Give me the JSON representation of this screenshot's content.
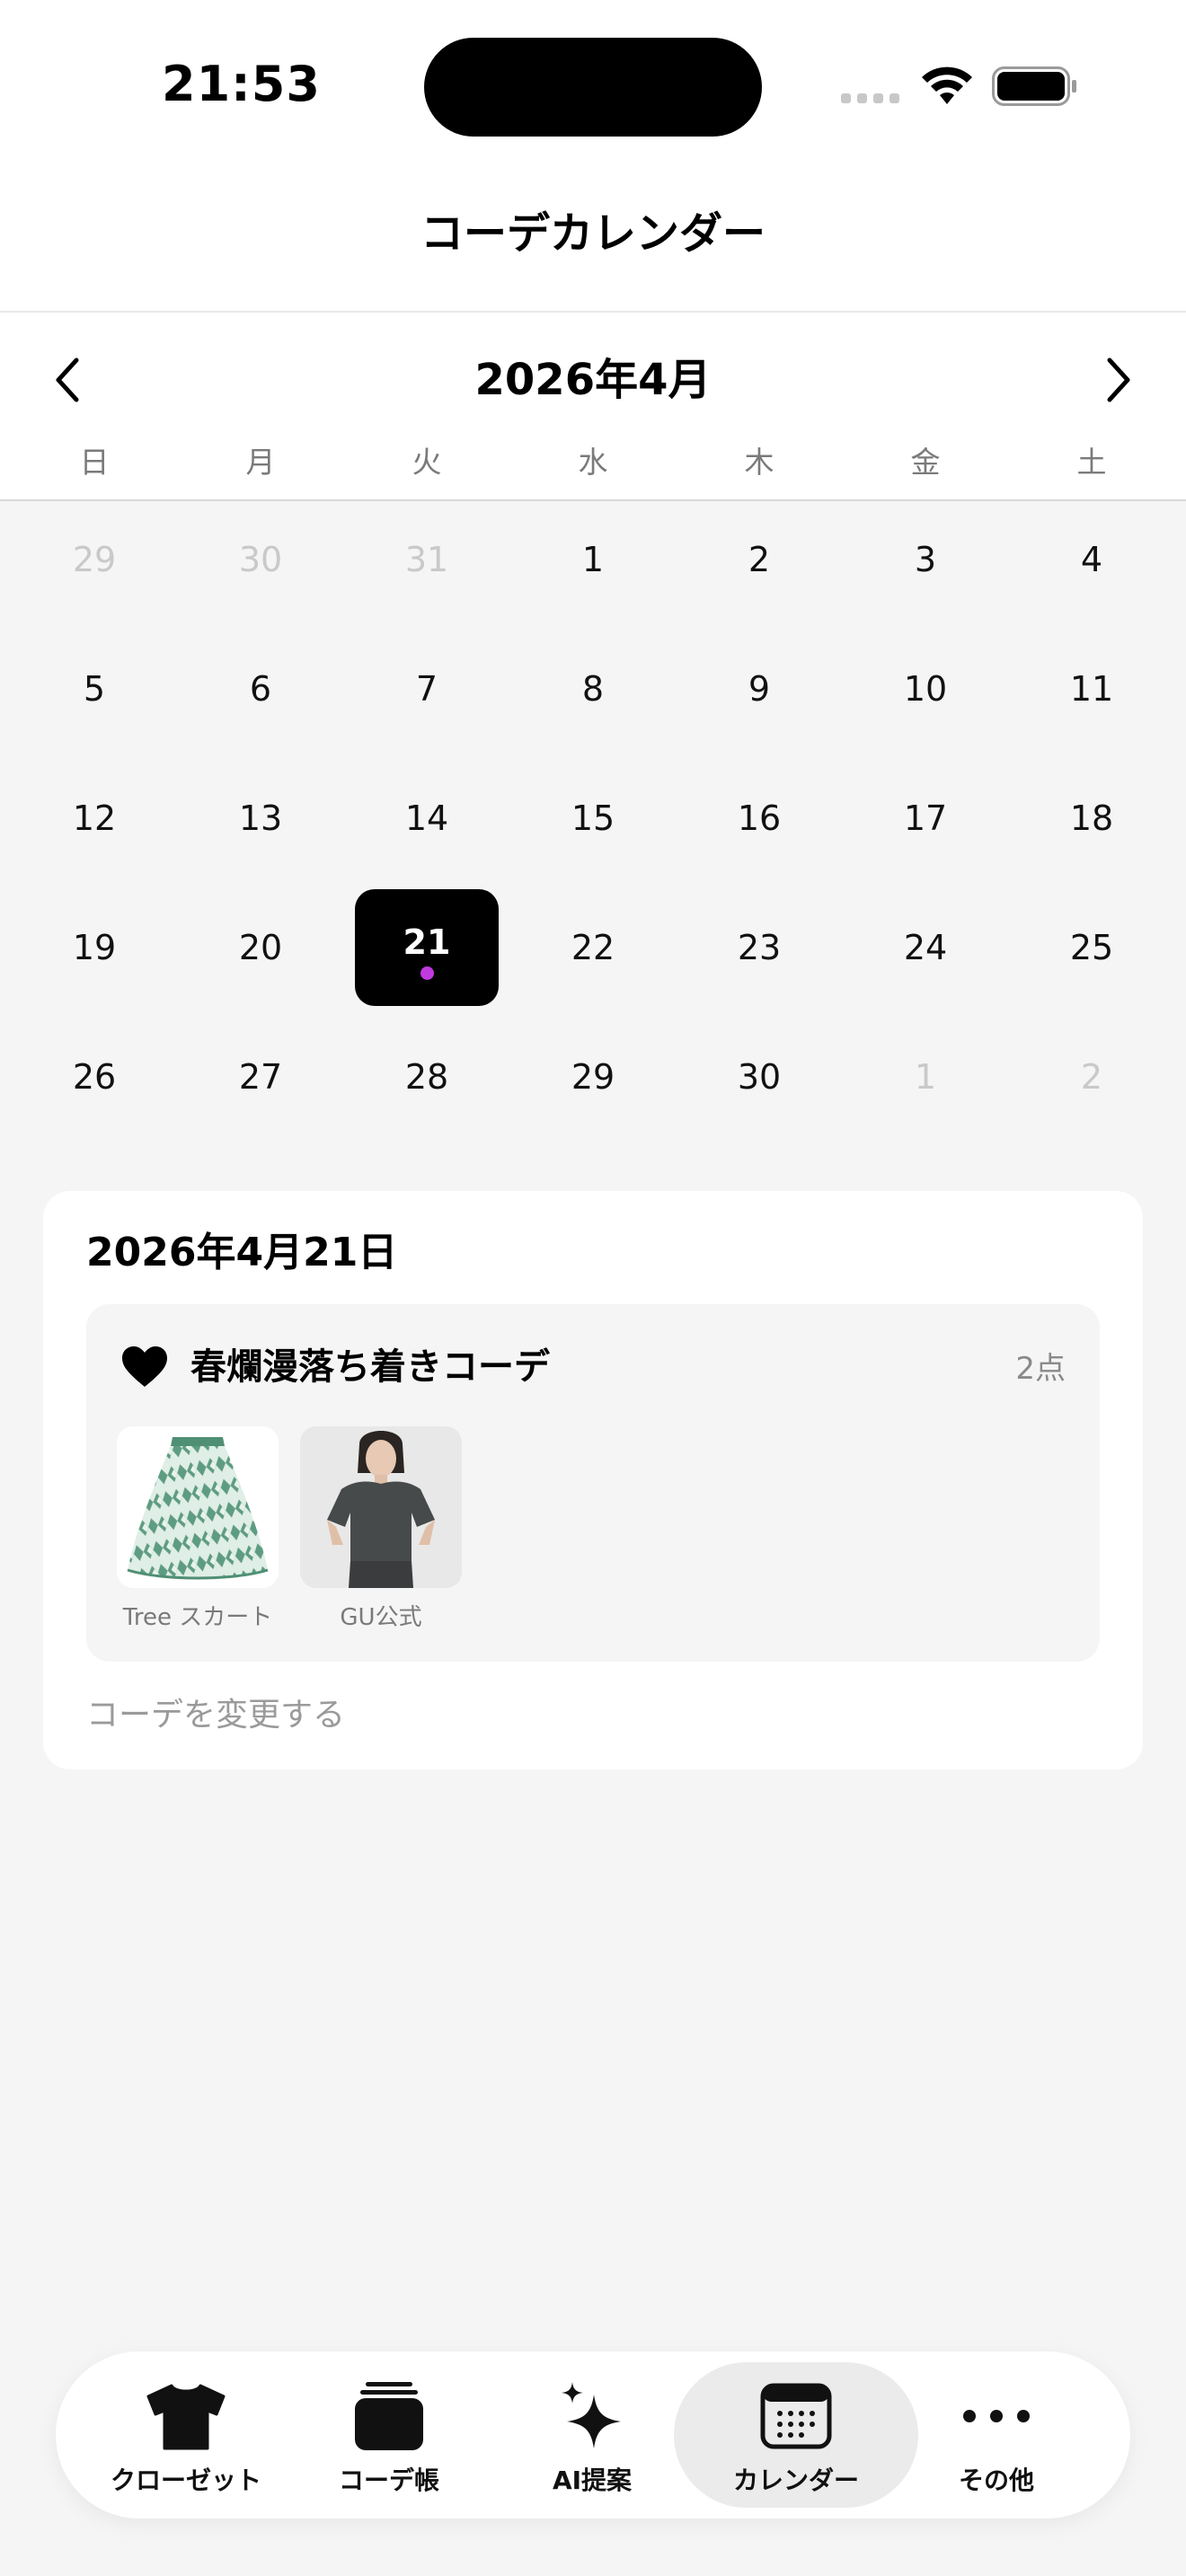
{
  "status_bar": {
    "time": "21:53"
  },
  "header": {
    "title": "コーデカレンダー"
  },
  "calendar": {
    "month_label": "2026年4月",
    "weekdays": [
      "日",
      "月",
      "火",
      "水",
      "木",
      "金",
      "土"
    ],
    "weeks": [
      [
        {
          "d": "29",
          "muted": true
        },
        {
          "d": "30",
          "muted": true
        },
        {
          "d": "31",
          "muted": true
        },
        {
          "d": "1"
        },
        {
          "d": "2"
        },
        {
          "d": "3"
        },
        {
          "d": "4"
        }
      ],
      [
        {
          "d": "5"
        },
        {
          "d": "6"
        },
        {
          "d": "7"
        },
        {
          "d": "8"
        },
        {
          "d": "9"
        },
        {
          "d": "10"
        },
        {
          "d": "11"
        }
      ],
      [
        {
          "d": "12"
        },
        {
          "d": "13"
        },
        {
          "d": "14"
        },
        {
          "d": "15"
        },
        {
          "d": "16"
        },
        {
          "d": "17"
        },
        {
          "d": "18"
        }
      ],
      [
        {
          "d": "19"
        },
        {
          "d": "20"
        },
        {
          "d": "21",
          "selected": true,
          "has_outfit": true
        },
        {
          "d": "22"
        },
        {
          "d": "23"
        },
        {
          "d": "24"
        },
        {
          "d": "25"
        }
      ],
      [
        {
          "d": "26"
        },
        {
          "d": "27"
        },
        {
          "d": "28"
        },
        {
          "d": "29"
        },
        {
          "d": "30"
        },
        {
          "d": "1",
          "muted": true
        },
        {
          "d": "2",
          "muted": true
        }
      ]
    ],
    "outfit_dot_color": "#c03adf"
  },
  "detail": {
    "date": "2026年4月21日",
    "outfit_name": "春爛漫落ち着きコーデ",
    "item_count": "2点",
    "items": [
      {
        "label": "Tree スカート",
        "icon": "skirt-photo"
      },
      {
        "label": "GU公式",
        "icon": "model-top-photo"
      }
    ],
    "change_link": "コーデを変更する"
  },
  "tabbar": {
    "tabs": [
      {
        "label": "クローゼット",
        "icon": "tshirt-icon",
        "active": false
      },
      {
        "label": "コーデ帳",
        "icon": "stack-icon",
        "active": false
      },
      {
        "label": "AI提案",
        "icon": "sparkles-icon",
        "active": false
      },
      {
        "label": "カレンダー",
        "icon": "calendar-icon",
        "active": true
      },
      {
        "label": "その他",
        "icon": "more-icon",
        "active": false
      }
    ]
  }
}
